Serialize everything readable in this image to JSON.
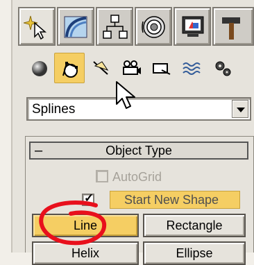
{
  "command_panel": {
    "tabs": [
      {
        "icon": "create-icon",
        "active": true
      },
      {
        "icon": "modify-icon",
        "active": false
      },
      {
        "icon": "hierarchy-icon",
        "active": false
      },
      {
        "icon": "motion-icon",
        "active": false
      },
      {
        "icon": "display-icon",
        "active": false
      },
      {
        "icon": "utilities-icon",
        "active": false
      }
    ],
    "categories": [
      {
        "icon": "geometry-sphere-icon",
        "active": false
      },
      {
        "icon": "shapes-icon",
        "active": true
      },
      {
        "icon": "lights-icon",
        "active": false
      },
      {
        "icon": "cameras-icon",
        "active": false
      },
      {
        "icon": "helpers-icon",
        "active": false
      },
      {
        "icon": "space-warps-icon",
        "active": false
      },
      {
        "icon": "systems-icon",
        "active": false
      }
    ],
    "category_dropdown": {
      "selected": "Splines"
    },
    "object_type_rollout": {
      "collapse_symbol": "–",
      "title": "Object Type",
      "autogrid": {
        "label": "AutoGrid",
        "checked": false,
        "enabled": false
      },
      "start_new_shape": {
        "label": "Start New Shape",
        "checked": true
      },
      "buttons": [
        {
          "label": "Line",
          "active": true
        },
        {
          "label": "Rectangle",
          "active": false
        },
        {
          "label": "Helix",
          "active": false
        },
        {
          "label": "Ellipse",
          "active": false
        }
      ]
    }
  },
  "colors": {
    "active_highlight": "#f5ce63",
    "panel_bg": "#e6e3dc",
    "annotation_red": "#e8101c"
  }
}
